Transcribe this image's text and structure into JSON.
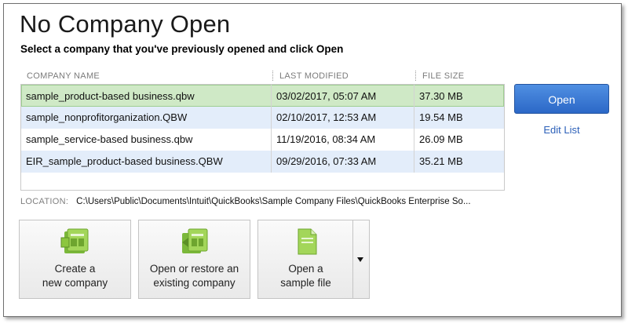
{
  "dialog": {
    "title": "No Company Open",
    "subtitle": "Select a company that you've previously opened and click Open"
  },
  "table": {
    "columns": [
      "COMPANY NAME",
      "LAST MODIFIED",
      "FILE SIZE"
    ],
    "rows": [
      {
        "name": "sample_product-based business.qbw",
        "modified": "03/02/2017, 05:07 AM",
        "size": "37.30 MB"
      },
      {
        "name": "sample_nonprofitorganization.QBW",
        "modified": "02/10/2017, 12:53 AM",
        "size": "19.54 MB"
      },
      {
        "name": "sample_service-based business.qbw",
        "modified": "11/19/2016, 08:34 AM",
        "size": "26.09 MB"
      },
      {
        "name": "EIR_sample_product-based business.QBW",
        "modified": "09/29/2016, 07:33 AM",
        "size": "35.21 MB"
      }
    ],
    "selected_index": 0
  },
  "buttons": {
    "open": "Open",
    "edit_list": "Edit List"
  },
  "location": {
    "label": "LOCATION:",
    "path": "C:\\Users\\Public\\Documents\\Intuit\\QuickBooks\\Sample Company Files\\QuickBooks Enterprise So..."
  },
  "actions": [
    {
      "label": "Create a\nnew company",
      "icon": "new-company-icon"
    },
    {
      "label": "Open or restore an\nexisting company",
      "icon": "open-restore-icon"
    },
    {
      "label": "Open a\nsample file",
      "icon": "sample-file-icon",
      "has_dropdown": true
    }
  ],
  "colors": {
    "selected_row": "#cfe9c6",
    "alternate_row": "#e3edfa",
    "open_button": "#3a78d6",
    "link": "#2b5fb8",
    "icon_green": "#8cc63f"
  }
}
